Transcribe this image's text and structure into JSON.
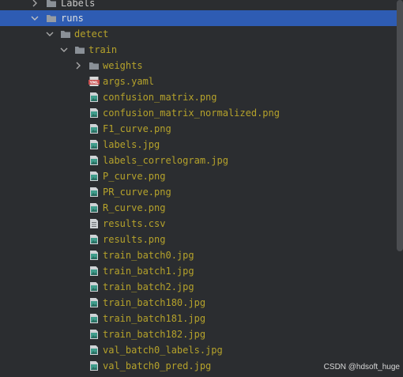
{
  "tree": {
    "top_item": {
      "label": "Labels"
    },
    "runs": {
      "label": "runs"
    },
    "detect": {
      "label": "detect"
    },
    "train": {
      "label": "train"
    },
    "weights": {
      "label": "weights"
    },
    "files": [
      {
        "label": "args.yaml",
        "icon": "yaml-icon"
      },
      {
        "label": "confusion_matrix.png",
        "icon": "image-file-icon"
      },
      {
        "label": "confusion_matrix_normalized.png",
        "icon": "image-file-icon"
      },
      {
        "label": "F1_curve.png",
        "icon": "image-file-icon"
      },
      {
        "label": "labels.jpg",
        "icon": "image-file-icon"
      },
      {
        "label": "labels_correlogram.jpg",
        "icon": "image-file-icon"
      },
      {
        "label": "P_curve.png",
        "icon": "image-file-icon"
      },
      {
        "label": "PR_curve.png",
        "icon": "image-file-icon"
      },
      {
        "label": "R_curve.png",
        "icon": "image-file-icon"
      },
      {
        "label": "results.csv",
        "icon": "text-file-icon"
      },
      {
        "label": "results.png",
        "icon": "image-file-icon"
      },
      {
        "label": "train_batch0.jpg",
        "icon": "image-file-icon"
      },
      {
        "label": "train_batch1.jpg",
        "icon": "image-file-icon"
      },
      {
        "label": "train_batch2.jpg",
        "icon": "image-file-icon"
      },
      {
        "label": "train_batch180.jpg",
        "icon": "image-file-icon"
      },
      {
        "label": "train_batch181.jpg",
        "icon": "image-file-icon"
      },
      {
        "label": "train_batch182.jpg",
        "icon": "image-file-icon"
      },
      {
        "label": "val_batch0_labels.jpg",
        "icon": "image-file-icon"
      },
      {
        "label": "val_batch0_pred.jpg",
        "icon": "image-file-icon"
      }
    ]
  },
  "watermark": "CSDN @hdsoft_huge",
  "colors": {
    "background": "#2b2d30",
    "selection": "#2f65ca",
    "folder_icon": "#8a9097",
    "modified_file_text": "#b5a22b",
    "image_icon": "#3f9d8c",
    "yaml_icon": "#c94f4f"
  }
}
